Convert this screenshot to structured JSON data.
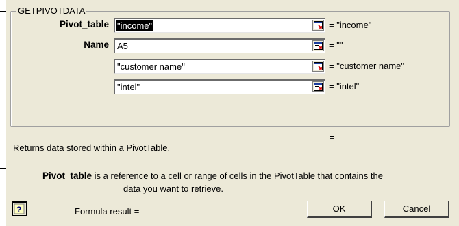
{
  "dialog": {
    "group_title": "GETPIVOTDATA",
    "arguments": [
      {
        "label": "Pivot_table",
        "value": "\"income\"",
        "result": "= \"income\""
      },
      {
        "label": "Name",
        "value": "A5",
        "result": "= \"\""
      },
      {
        "label": "",
        "value": "\"customer name\"",
        "result": "= \"customer name\""
      },
      {
        "label": "",
        "value": "\"intel\"",
        "result": "= \"intel\""
      }
    ],
    "result_equals": "=",
    "description": "Returns data stored within a PivotTable.",
    "detail_arg": "Pivot_table",
    "detail_line1": "is a reference to a cell or range of cells in the PivotTable that contains the",
    "detail_line2": "data you want to retrieve.",
    "formula_result_label": "Formula result =",
    "ok_label": "OK",
    "cancel_label": "Cancel",
    "help_icon": "help-question-icon",
    "ref_icon": "collapse-dialog-icon"
  }
}
